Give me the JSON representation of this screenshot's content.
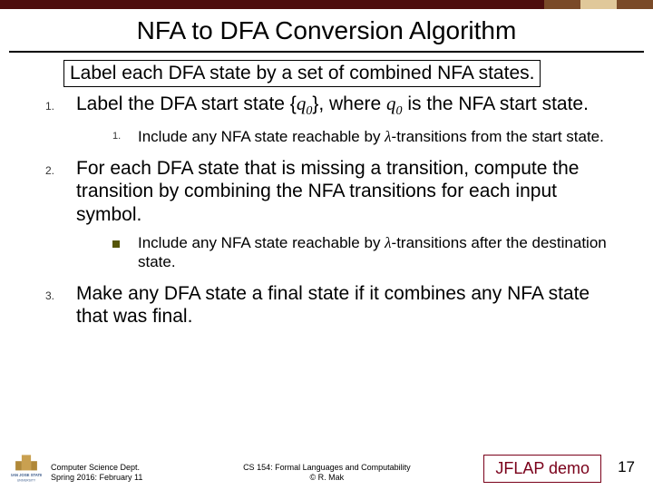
{
  "title": "NFA to DFA Conversion Algorithm",
  "intro": "Label each DFA state by a set of combined NFA states.",
  "items": [
    {
      "marker": "1.",
      "text_a": "Label the DFA start state {",
      "q": "q",
      "sub0": "0",
      "text_b": "}, where ",
      "q2": "q",
      "sub0b": "0",
      "text_c": " is the NFA start state.",
      "sub": {
        "marker": "1.",
        "text_a": "Include any NFA state reachable by ",
        "lambda": "λ",
        "text_b": "-transitions from the start state."
      }
    },
    {
      "marker": "2.",
      "text_a": "For each DFA state that is missing a transition, compute the transition by combining the NFA transitions for each input symbol.",
      "sub": {
        "marker": "square",
        "text_a": "Include any NFA state reachable by ",
        "lambda": "λ",
        "text_b": "-transitions after the destination state."
      }
    },
    {
      "marker": "3.",
      "text_a": "Make any DFA state a final state if it combines any NFA state that was final."
    }
  ],
  "footer": {
    "dept_line1": "Computer Science Dept.",
    "dept_line2": "Spring 2016: February 11",
    "course_line1": "CS 154: Formal Languages and Computability",
    "course_line2": "© R. Mak",
    "demo": "JFLAP demo",
    "page": "17"
  }
}
